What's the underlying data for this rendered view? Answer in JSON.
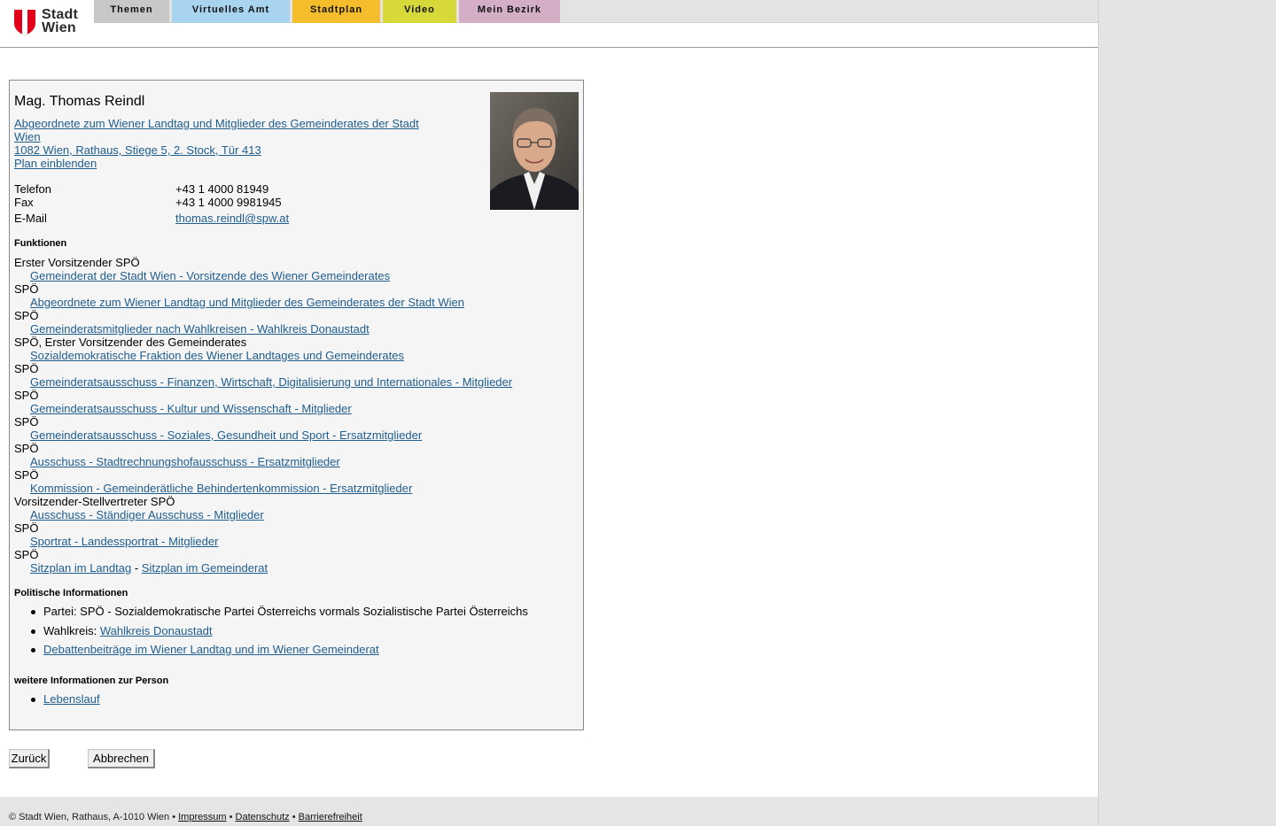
{
  "logo": {
    "line1": "Stadt",
    "line2": "Wien"
  },
  "nav": [
    {
      "label": "Themen",
      "color": "#c8c8c8"
    },
    {
      "label": "Virtuelles Amt",
      "color": "#a9d4f0"
    },
    {
      "label": "Stadtplan",
      "color": "#f5bd2b"
    },
    {
      "label": "Video",
      "color": "#d7d83a"
    },
    {
      "label": "Mein Bezirk",
      "color": "#d4aec7"
    }
  ],
  "person": {
    "name": "Mag. Thomas Reindl",
    "title_line1": "Abgeordnete zum Wiener Landtag und Mitglieder des Gemeinderates der Stadt",
    "title_line2": "Wien ",
    "address": "1082 Wien, Rathaus, Stiege 5, 2. Stock, Tür 413",
    "plan_link": "Plan einblenden",
    "phone_label": "Telefon",
    "phone": "+43 1 4000 81949",
    "fax_label": "Fax",
    "fax": "+43 1 4000 9981945",
    "email_label": "E-Mail",
    "email": "thomas.reindl@spw.at"
  },
  "functions_heading": "Funktionen",
  "functions": [
    {
      "role": "Erster Vorsitzender SPÖ",
      "link": "Gemeinderat der Stadt Wien - Vorsitzende des Wiener Gemeinderates"
    },
    {
      "role": "SPÖ",
      "link": "Abgeordnete zum Wiener Landtag und Mitglieder des Gemeinderates der Stadt Wien"
    },
    {
      "role": "SPÖ",
      "link": "Gemeinderatsmitglieder nach Wahlkreisen - Wahlkreis Donaustadt"
    },
    {
      "role": "SPÖ, Erster Vorsitzender des Gemeinderates",
      "link": "Sozialdemokratische Fraktion des Wiener Landtages und Gemeinderates"
    },
    {
      "role": "SPÖ",
      "link": "Gemeinderatsausschuss - Finanzen, Wirtschaft, Digitalisierung und Internationales - Mitglieder"
    },
    {
      "role": "SPÖ",
      "link": "Gemeinderatsausschuss - Kultur und Wissenschaft - Mitglieder"
    },
    {
      "role": "SPÖ",
      "link": "Gemeinderatsausschuss - Soziales, Gesundheit und Sport - Ersatzmitglieder"
    },
    {
      "role": "SPÖ",
      "link": "Ausschuss - Stadtrechnungshofausschuss - Ersatzmitglieder"
    },
    {
      "role": "SPÖ",
      "link": "Kommission - Gemeinderätliche Behindertenkommission - Ersatzmitglieder"
    },
    {
      "role": "Vorsitzender-Stellvertreter SPÖ",
      "link": "Ausschuss - Ständiger Ausschuss - Mitglieder"
    },
    {
      "role": "SPÖ",
      "link": "Sportrat - Landessportrat - Mitglieder"
    },
    {
      "role": "SPÖ"
    }
  ],
  "sitzplan": {
    "landtag": "Sitzplan im Landtag",
    "separator": "-",
    "gemeinderat": "Sitzplan im Gemeinderat"
  },
  "political_heading": "Politische Informationen",
  "political": {
    "party": "Partei: SPÖ - Sozialdemokratische Partei Österreichs vormals Sozialistische Partei Österreichs",
    "wahlkreis_label": "Wahlkreis:",
    "wahlkreis_link": "Wahlkreis Donaustadt",
    "debates_link": "Debattenbeiträge im Wiener Landtag und im Wiener Gemeinderat"
  },
  "further_heading": "weitere Informationen zur Person",
  "further": {
    "cv_link": "Lebenslauf"
  },
  "buttons": {
    "back": "Zurück",
    "cancel": "Abbrechen"
  },
  "footer": {
    "copyright": "© Stadt Wien, Rathaus, A-1010 Wien",
    "sep": "•",
    "impressum": "Impressum",
    "datenschutz": "Datenschutz",
    "barrierefreiheit": "Barrierefreiheit"
  },
  "colors": {
    "link": "#1f5d8c",
    "logo_red": "#e2001a",
    "panel_bg": "#f5f5f5"
  }
}
